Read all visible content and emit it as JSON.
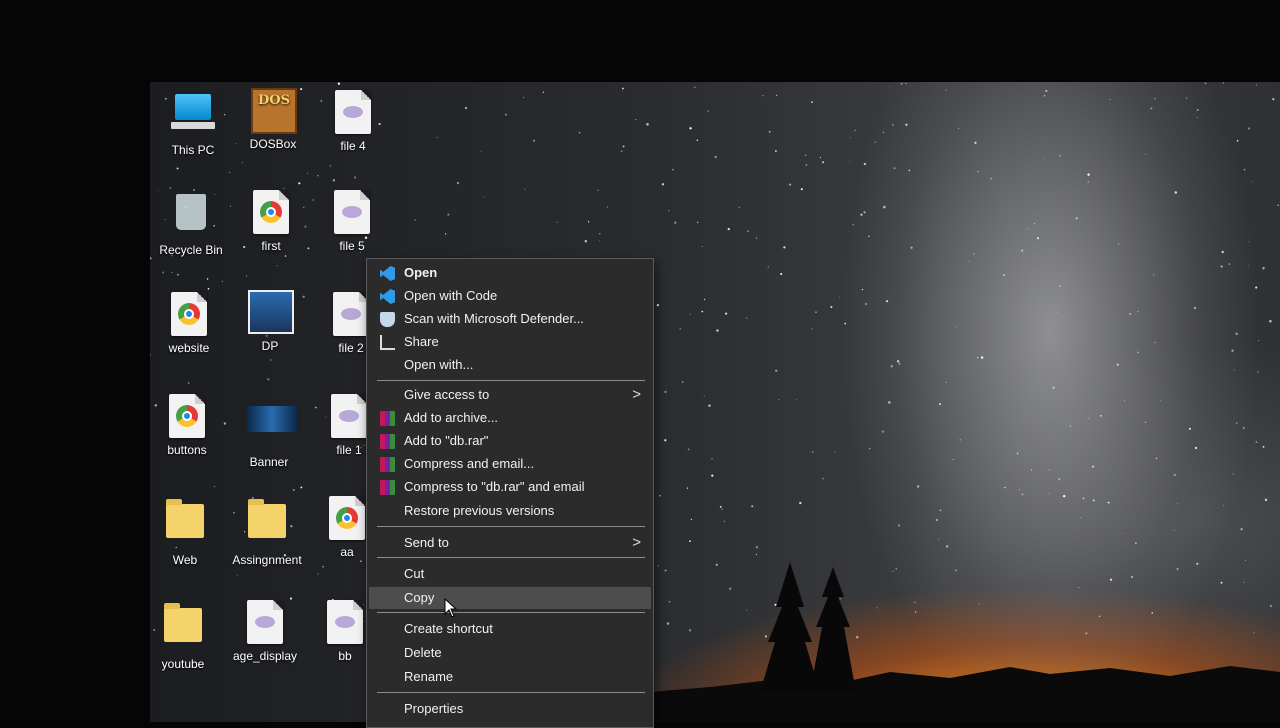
{
  "desktop": {
    "icons": [
      {
        "label": "This PC",
        "icon": "pc-icon"
      },
      {
        "label": "DOSBox",
        "icon": "dosbox-icon",
        "glyph_text": "DOS"
      },
      {
        "label": "file 4",
        "icon": "php-file-icon"
      },
      {
        "label": "Recycle Bin",
        "icon": "recycle-bin-icon"
      },
      {
        "label": "first",
        "icon": "chrome-file-icon"
      },
      {
        "label": "file 5",
        "icon": "php-file-icon"
      },
      {
        "label": "website",
        "icon": "chrome-file-icon"
      },
      {
        "label": "DP",
        "icon": "image-icon"
      },
      {
        "label": "file 2",
        "icon": "php-file-icon"
      },
      {
        "label": "buttons",
        "icon": "chrome-file-icon"
      },
      {
        "label": "Banner",
        "icon": "banner-image-icon"
      },
      {
        "label": "file 1",
        "icon": "php-file-icon"
      },
      {
        "label": "Web",
        "icon": "folder-icon"
      },
      {
        "label": "Assingnment",
        "icon": "folder-icon"
      },
      {
        "label": "aa",
        "icon": "chrome-file-icon"
      },
      {
        "label": "youtube",
        "icon": "folder-icon"
      },
      {
        "label": "age_display",
        "icon": "php-file-icon"
      },
      {
        "label": "bb",
        "icon": "php-file-icon"
      }
    ]
  },
  "context_menu": {
    "items": [
      {
        "label": "Open",
        "icon": "vscode-icon"
      },
      {
        "label": "Open with Code",
        "icon": "vscode-icon"
      },
      {
        "label": "Scan with Microsoft Defender...",
        "icon": "defender-shield-icon"
      },
      {
        "label": "Share",
        "icon": "share-icon"
      },
      {
        "label": "Open with...",
        "icon": ""
      },
      {
        "label": "Give access to",
        "icon": "",
        "submenu_arrow": ">"
      },
      {
        "label": "Add to archive...",
        "icon": "winrar-icon"
      },
      {
        "label": "Add to \"db.rar\"",
        "icon": "winrar-icon"
      },
      {
        "label": "Compress and email...",
        "icon": "winrar-icon"
      },
      {
        "label": "Compress to \"db.rar\" and email",
        "icon": "winrar-icon"
      },
      {
        "label": "Restore previous versions",
        "icon": ""
      },
      {
        "label": "Send to",
        "icon": "",
        "submenu_arrow": ">"
      },
      {
        "label": "Cut",
        "icon": ""
      },
      {
        "label": "Copy",
        "icon": "",
        "hovered": true
      },
      {
        "label": "Create shortcut",
        "icon": ""
      },
      {
        "label": "Delete",
        "icon": ""
      },
      {
        "label": "Rename",
        "icon": ""
      },
      {
        "label": "Properties",
        "icon": ""
      }
    ]
  },
  "colors": {
    "menu_bg": "#2b2b2b",
    "menu_hover": "#4d4d4d",
    "horizon_glow": "#ff9114",
    "vscode_blue": "#2f9ae8"
  }
}
